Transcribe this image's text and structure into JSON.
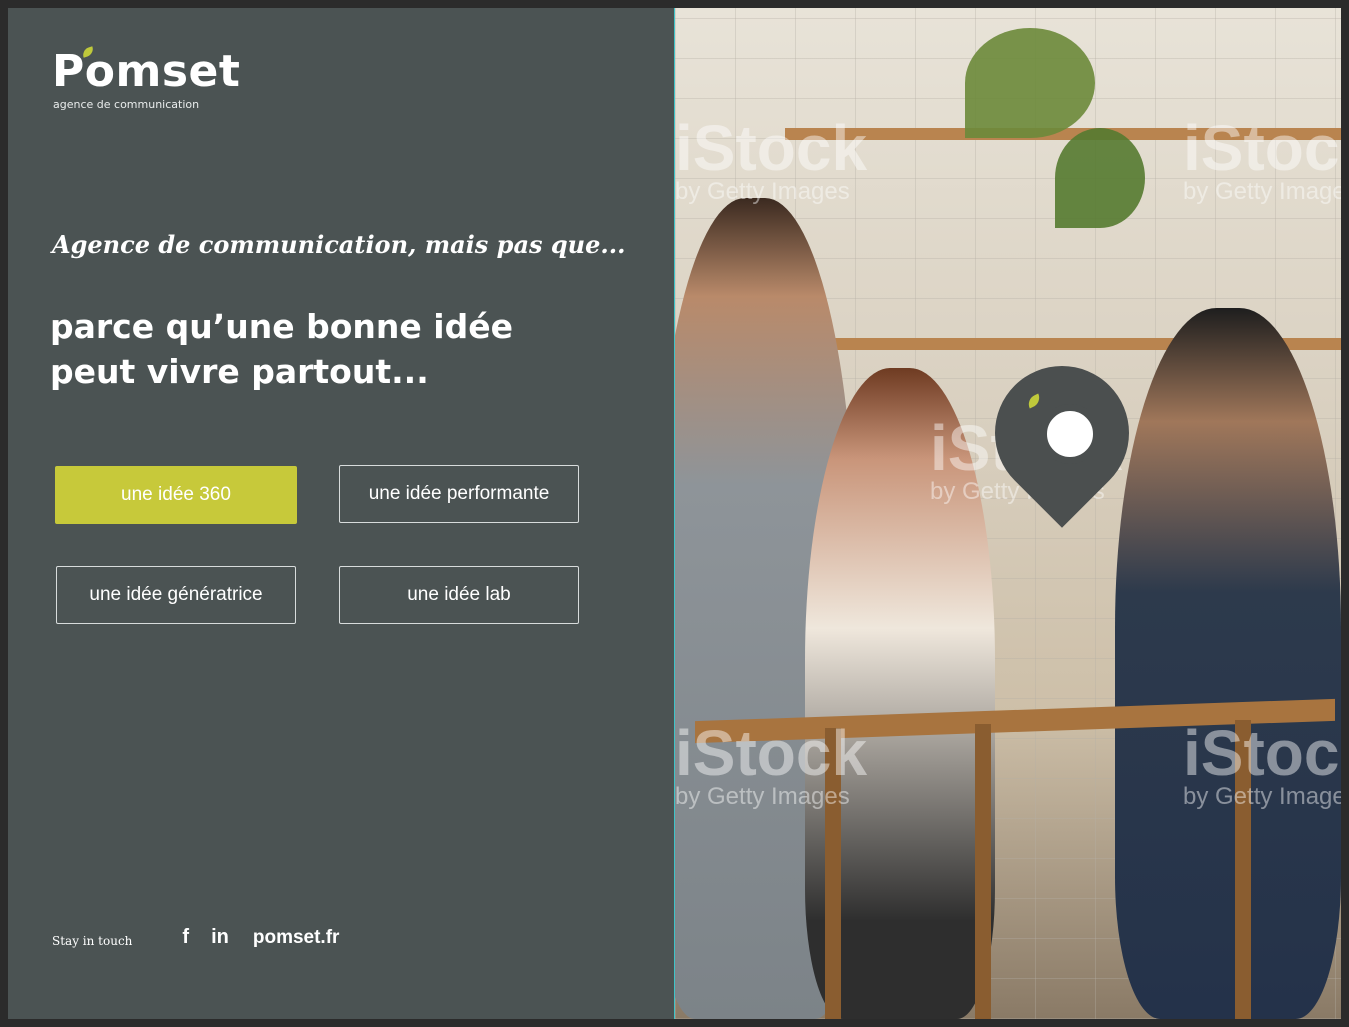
{
  "brand": {
    "name": "Pomset",
    "subtitle": "agence de communication"
  },
  "hero": {
    "tagline": "Agence de communication, mais pas que...",
    "headline_line1": "parce qu’une bonne idée",
    "headline_line2": "peut vivre partout..."
  },
  "buttons": [
    {
      "label": "une idée 360",
      "active": true
    },
    {
      "label": "une idée performante",
      "active": false
    },
    {
      "label": "une idée génératrice",
      "active": false
    },
    {
      "label": "une idée lab",
      "active": false
    }
  ],
  "footer": {
    "stay_label": "Stay in touch",
    "facebook_icon": "f",
    "linkedin_icon": "in",
    "site": "pomset.fr"
  },
  "image": {
    "watermark_brand": "iStock",
    "watermark_sub": "by Getty Images"
  },
  "colors": {
    "panel_bg": "#4b5353",
    "accent": "#c7c93a",
    "divider": "#3fc4c8"
  }
}
